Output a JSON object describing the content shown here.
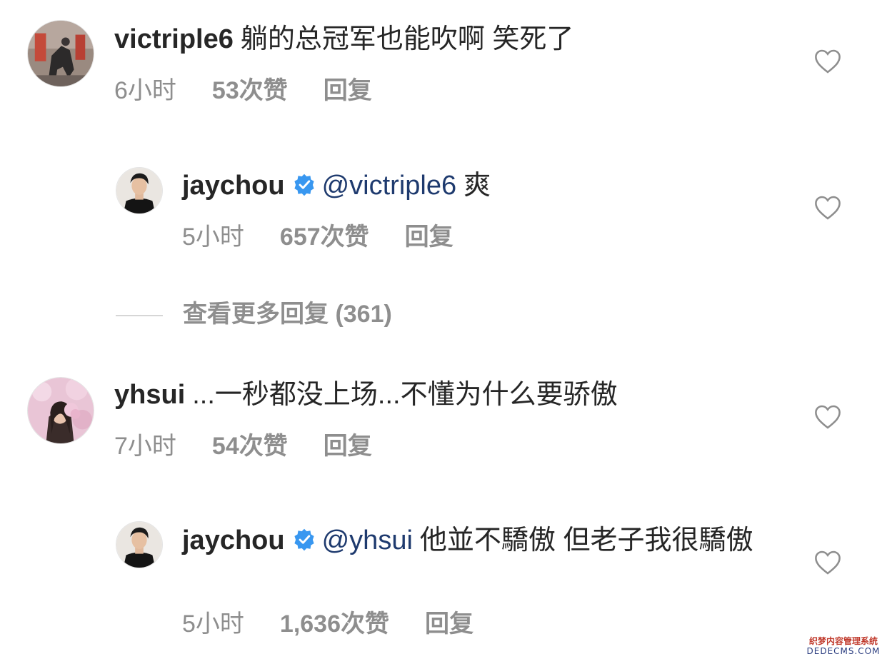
{
  "comments": [
    {
      "username": "victriple6",
      "text": "躺的总冠军也能吹啊  笑死了",
      "time": "6小时",
      "likes": "53次赞",
      "reply": "回复"
    },
    {
      "username": "jaychou",
      "mention": "@victriple6",
      "text": "爽",
      "time": "5小时",
      "likes": "657次赞",
      "reply": "回复"
    },
    {
      "username": "yhsui",
      "text": "...一秒都没上场...不懂为什么要骄傲",
      "time": "7小时",
      "likes": "54次赞",
      "reply": "回复"
    },
    {
      "username": "jaychou",
      "mention": "@yhsui",
      "text": "他並不驕傲 但老子我很驕傲",
      "time": "5小时",
      "likes": "1,636次赞",
      "reply": "回复"
    }
  ],
  "more_replies": "查看更多回复 (361)",
  "watermark": {
    "line1": "织梦内容管理系统",
    "line2": "DEDECMS.COM"
  },
  "colors": {
    "text": "#262626",
    "meta": "#8e8e8e",
    "mention": "#1e3a6e",
    "verified": "#3897f0"
  }
}
